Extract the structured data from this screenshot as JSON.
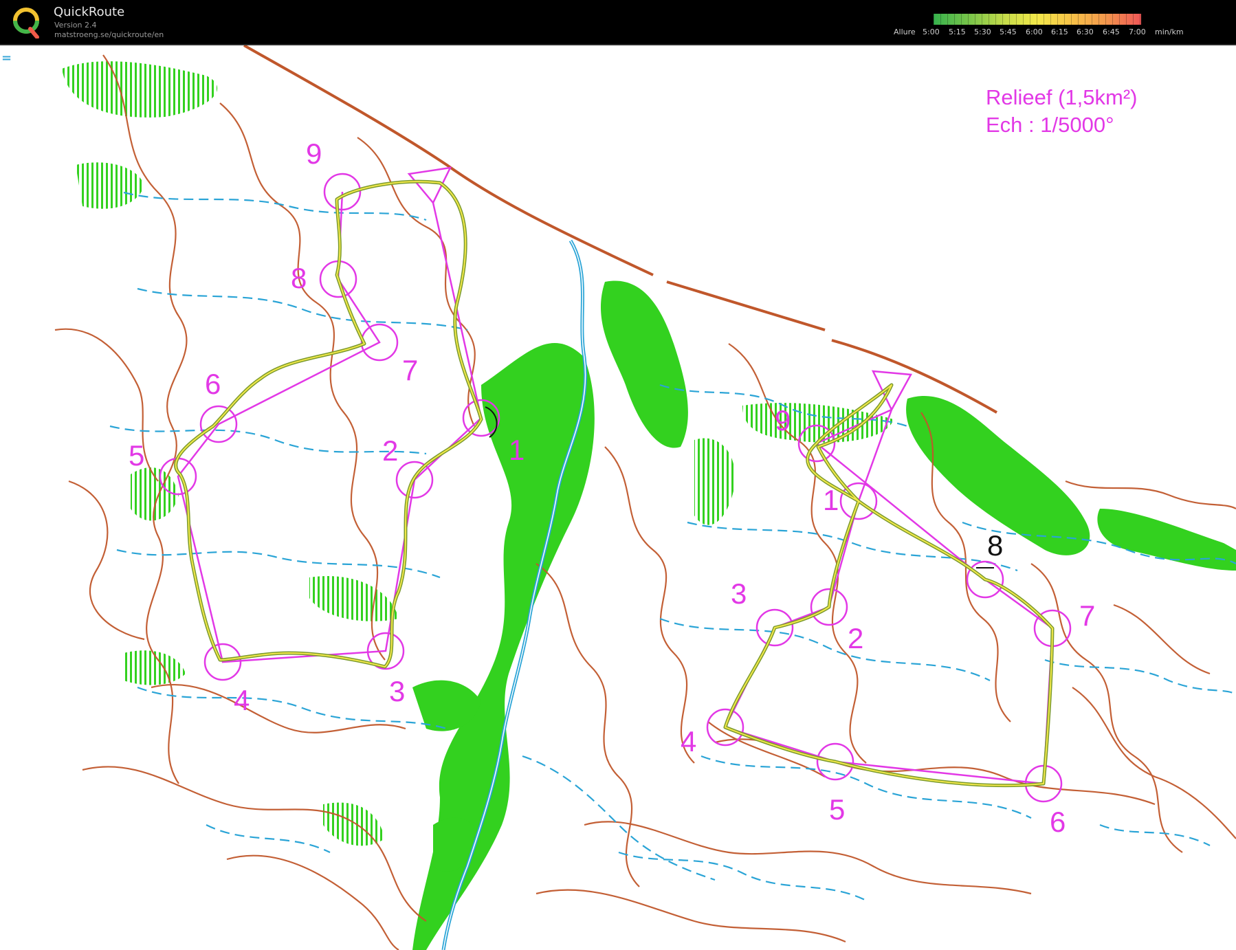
{
  "app": {
    "title": "QuickRoute",
    "version": "Version 2.4",
    "url": "matstroeng.se/quickroute/en"
  },
  "pace_scale": {
    "label": "Allure",
    "unit": "min/km",
    "ticks": [
      "5:00",
      "5:15",
      "5:30",
      "5:45",
      "6:00",
      "6:15",
      "6:30",
      "6:45",
      "7:00"
    ],
    "colors": [
      "#37b24d",
      "#c9dd4a",
      "#f3e84a",
      "#f39a4c",
      "#f05757"
    ]
  },
  "menu_icon": "menu-icon",
  "map": {
    "title": "Relieef (1,5km²)",
    "scale": "Ech : 1/5000°",
    "colors": {
      "course": "#e238e6",
      "contour": "#c0572b",
      "water": "#2aa4d6",
      "vegetation": "#33d11f"
    },
    "course_left": {
      "controls": [
        "1",
        "2",
        "3",
        "4",
        "5",
        "6",
        "7",
        "8",
        "9"
      ]
    },
    "course_right": {
      "controls": [
        "1",
        "2",
        "3",
        "4",
        "5",
        "6",
        "7",
        "8",
        "9"
      ]
    }
  }
}
